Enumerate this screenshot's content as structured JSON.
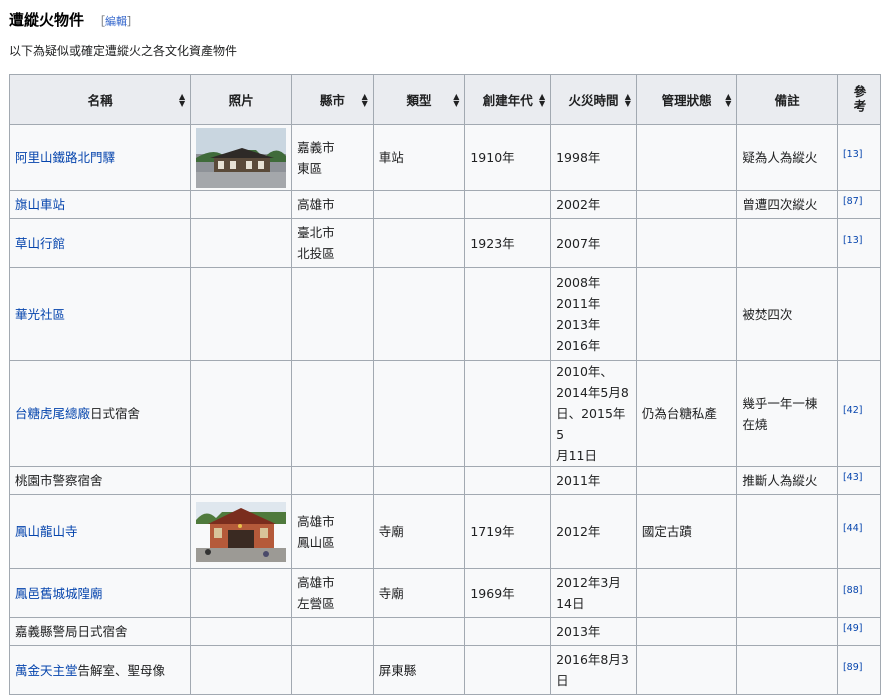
{
  "section": {
    "title": "遭縱火物件",
    "edit_open": "［",
    "edit_label": "編輯",
    "edit_close": "］"
  },
  "intro": "以下為疑似或確定遭縱火之各文化資產物件",
  "table": {
    "headers": [
      "名稱",
      "照片",
      "縣市",
      "類型",
      "創建年代",
      "火災時間",
      "管理狀態",
      "備註",
      "參考"
    ],
    "rows": [
      {
        "name_link": "阿里山鐵路北門驛",
        "name_rest": "",
        "photo": "station-photo",
        "city": [
          "嘉義市",
          "東區"
        ],
        "type": "車站",
        "year": "1910年",
        "fire": [
          "1998年"
        ],
        "status": "",
        "note": [
          "疑為人為縱火"
        ],
        "ref": "[13]"
      },
      {
        "name_link": "旗山車站",
        "name_rest": "",
        "photo": "",
        "city": [
          "高雄市"
        ],
        "type": "",
        "year": "",
        "fire": [
          "2002年"
        ],
        "status": "",
        "note": [
          "曾遭四次縱火"
        ],
        "ref": "[87]"
      },
      {
        "name_link": "草山行館",
        "name_rest": "",
        "photo": "",
        "city": [
          "臺北市",
          "北投區"
        ],
        "type": "",
        "year": "1923年",
        "fire": [
          "2007年"
        ],
        "status": "",
        "note": [],
        "ref": "[13]"
      },
      {
        "name_link": "華光社區",
        "name_rest": "",
        "photo": "",
        "city": [],
        "type": "",
        "year": "",
        "fire": [
          "2008年",
          "2011年",
          "2013年",
          "2016年"
        ],
        "status": "",
        "note": [
          "被焚四次"
        ],
        "ref": ""
      },
      {
        "name_link": "台糖虎尾總廠",
        "name_rest": "日式宿舍",
        "photo": "",
        "city": [],
        "type": "",
        "year": "",
        "fire": [
          "2010年、",
          "2014年5月8",
          "日、2015年5",
          "月11日"
        ],
        "status": "仍為台糖私產",
        "note": [
          "幾乎一年一棟",
          "在燒"
        ],
        "ref": "[42]"
      },
      {
        "name_link": "",
        "name_rest": "桃園市警察宿舍",
        "photo": "",
        "city": [],
        "type": "",
        "year": "",
        "fire": [
          "2011年"
        ],
        "status": "",
        "note": [
          "推斷人為縱火"
        ],
        "ref": "[43]"
      },
      {
        "name_link": "鳳山龍山寺",
        "name_rest": "",
        "photo": "temple-photo",
        "city": [
          "高雄市",
          "鳳山區"
        ],
        "type": "寺廟",
        "year": "1719年",
        "fire": [
          "2012年"
        ],
        "status": "國定古蹟",
        "note": [],
        "ref": "[44]"
      },
      {
        "name_link": "鳳邑舊城城隍廟",
        "name_rest": "",
        "photo": "",
        "city": [
          "高雄市",
          "左營區"
        ],
        "type": "寺廟",
        "year": "1969年",
        "fire": [
          "2012年3月",
          "14日"
        ],
        "status": "",
        "note": [],
        "ref": "[88]"
      },
      {
        "name_link": "",
        "name_rest": "嘉義縣警局日式宿舍",
        "photo": "",
        "city": [],
        "type": "",
        "year": "",
        "fire": [
          "2013年"
        ],
        "status": "",
        "note": [],
        "ref": "[49]"
      },
      {
        "name_link": "萬金天主堂",
        "name_rest": "告解室、聖母像",
        "photo": "",
        "city": [],
        "type": "屏東縣",
        "year": "",
        "fire": [
          "2016年8月3",
          "日"
        ],
        "status": "",
        "note": [],
        "ref": "[89]"
      }
    ]
  }
}
